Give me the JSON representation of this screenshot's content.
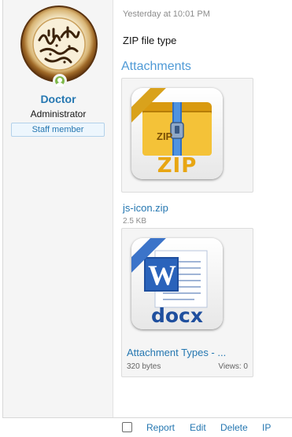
{
  "user": {
    "name": "Doctor",
    "title": "Administrator",
    "banner": "Staff member",
    "online_status": "online"
  },
  "message": {
    "date": "Yesterday at 10:01 PM",
    "body": "ZIP file type",
    "attachments_heading": "Attachments"
  },
  "attachments": [
    {
      "icon": "zip-file-icon",
      "icon_label": "ZIP",
      "icon_small_label": "ZIP",
      "filename": "js-icon.zip",
      "size": "2.5 KB"
    },
    {
      "icon": "docx-file-icon",
      "icon_label": "docx",
      "icon_letter": "W",
      "title": "Attachment Types - ...",
      "size": "320 bytes",
      "views": "Views: 0"
    }
  ],
  "controls": {
    "report": "Report",
    "edit": "Edit",
    "delete": "Delete",
    "ip": "IP"
  },
  "colors": {
    "link": "#2577b1",
    "heading": "#4f9ad6",
    "online": "#7fb94a",
    "zip_gold": "#e8b018",
    "docx_blue": "#1f4f9e"
  }
}
